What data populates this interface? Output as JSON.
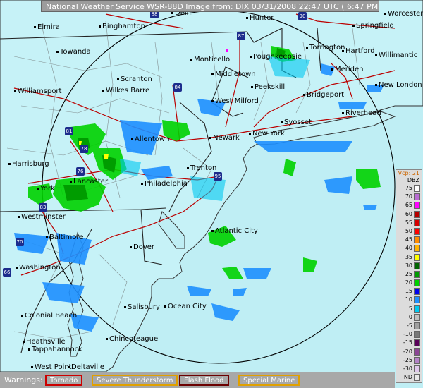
{
  "title": "National Weather Service WSR-88D Image from: DIX 03/31/2008 22:47 UTC ( 6:47 PM EDT)",
  "cities": [
    "Elmira",
    "Binghamton",
    "Delhi",
    "Hunter",
    "Worcester",
    "Springfield",
    "Towanda",
    "Monticello",
    "Poughkeepsie",
    "Torrington",
    "Hartford",
    "Willimantic",
    "Meriden",
    "Middletown",
    "Scranton",
    "Wilkes Barre",
    "Peekskill",
    "New London",
    "Bridgeport",
    "Williamsport",
    "West Milford",
    "Riverhead",
    "Syosset",
    "Allentown",
    "Newark",
    "New York",
    "Harrisburg",
    "Trenton",
    "Lancaster",
    "York",
    "Philadelphia",
    "Westminster",
    "Atlantic City",
    "Baltimore",
    "Dover",
    "Washington",
    "Salisbury",
    "Ocean City",
    "Colonial Beach",
    "Chincoteague",
    "Heathsville",
    "Tappahannock",
    "West Point",
    "Deltaville"
  ],
  "route_shields": [
    "88",
    "90",
    "87",
    "84",
    "81",
    "78",
    "76",
    "95",
    "83",
    "70",
    "66"
  ],
  "legend": {
    "vcp": "Vcp: 21",
    "unit": "DBZ",
    "levels": [
      {
        "label": "75",
        "color": "#ffffff"
      },
      {
        "label": "70",
        "color": "#b96cd3"
      },
      {
        "label": "65",
        "color": "#ff00ff"
      },
      {
        "label": "60",
        "color": "#b80000"
      },
      {
        "label": "55",
        "color": "#d60000"
      },
      {
        "label": "50",
        "color": "#ff0000"
      },
      {
        "label": "45",
        "color": "#ff8c00"
      },
      {
        "label": "40",
        "color": "#ffb400"
      },
      {
        "label": "35",
        "color": "#ffff00"
      },
      {
        "label": "30",
        "color": "#006400"
      },
      {
        "label": "25",
        "color": "#009c00"
      },
      {
        "label": "20",
        "color": "#00d200"
      },
      {
        "label": "15",
        "color": "#0000f0"
      },
      {
        "label": "10",
        "color": "#1e90ff"
      },
      {
        "label": "5",
        "color": "#00c8f0"
      },
      {
        "label": "0",
        "color": "#c0c0c0"
      },
      {
        "label": "-5",
        "color": "#a0a0a0"
      },
      {
        "label": "-10",
        "color": "#787878"
      },
      {
        "label": "-15",
        "color": "#5a005a"
      },
      {
        "label": "-20",
        "color": "#8c4696"
      },
      {
        "label": "-25",
        "color": "#b482c8"
      },
      {
        "label": "-30",
        "color": "#e0c8ec"
      },
      {
        "label": "ND",
        "color": "#e8e8e8"
      }
    ]
  },
  "warnings": {
    "label": "Warnings:",
    "items": [
      {
        "label": "Tornado",
        "color": "#cc0000"
      },
      {
        "label": "Severe Thunderstorm",
        "color": "#e0a000"
      },
      {
        "label": "Flash Flood",
        "color": "#6b0000"
      },
      {
        "label": "Special Marine",
        "color": "#e0a000"
      }
    ]
  }
}
